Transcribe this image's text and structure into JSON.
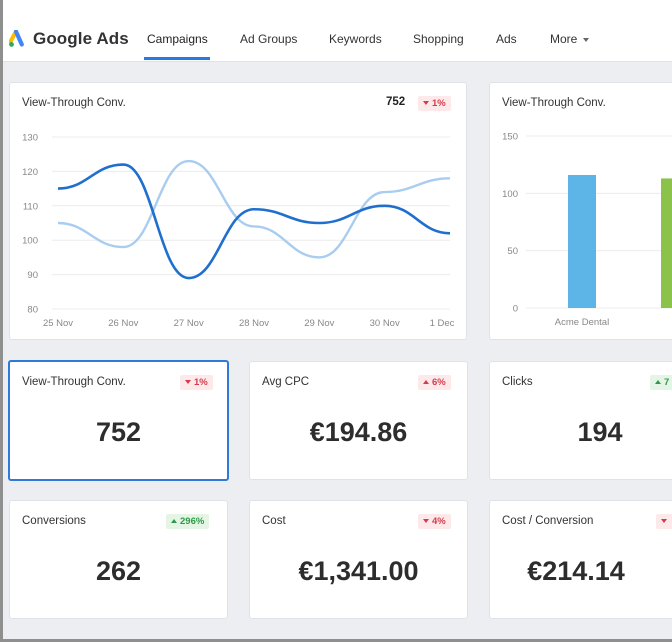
{
  "app": {
    "brand_name": "Google Ads",
    "nav": [
      {
        "label": "Campaigns",
        "active": true
      },
      {
        "label": "Ad Groups",
        "active": false
      },
      {
        "label": "Keywords",
        "active": false
      },
      {
        "label": "Shopping",
        "active": false
      },
      {
        "label": "Ads",
        "active": false
      },
      {
        "label": "More",
        "active": false
      }
    ],
    "accent_color": "#2b78e4"
  },
  "line_card": {
    "title": "View-Through Conv.",
    "total": "752",
    "badge": "1%"
  },
  "bar_card": {
    "title": "View-Through Conv."
  },
  "metrics": [
    {
      "title": "View-Through Conv.",
      "value": "752",
      "badge": "1%",
      "direction": "down",
      "badge_color": "#d23c4c"
    },
    {
      "title": "Avg CPC",
      "value": "€194.86",
      "badge": "6%",
      "direction": "up",
      "badge_color": "#d23c4c"
    },
    {
      "title": "Clicks",
      "value": "194",
      "badge": "7",
      "direction": "up",
      "badge_color": "#2f9a46"
    },
    {
      "title": "Conversions",
      "value": "262",
      "badge": "296%",
      "direction": "up",
      "badge_color": "#2f9a46"
    },
    {
      "title": "Cost",
      "value": "€1,341.00",
      "badge": "4%",
      "direction": "down",
      "badge_color": "#d23c4c"
    },
    {
      "title": "Cost / Conversion",
      "value": "€214.14",
      "badge": "",
      "direction": "down",
      "badge_color": "#d23c4c"
    }
  ],
  "chart_data": [
    {
      "type": "line",
      "title": "View-Through Conv.",
      "x": [
        "25 Nov",
        "26 Nov",
        "27 Nov",
        "28 Nov",
        "29 Nov",
        "30 Nov",
        "1 Dec"
      ],
      "ylim": [
        80,
        130
      ],
      "yticks": [
        80,
        90,
        100,
        110,
        120,
        130
      ],
      "grid": true,
      "series": [
        {
          "values": [
            115,
            122,
            89,
            109,
            105,
            110,
            102
          ],
          "color": "#1f6fcf"
        },
        {
          "values": [
            105,
            98,
            123,
            104,
            95,
            114,
            118
          ],
          "color": "#a9cdf0"
        }
      ]
    },
    {
      "type": "bar",
      "title": "View-Through Conv.",
      "categories": [
        "Acme Dental",
        "Ac"
      ],
      "values": [
        116,
        113
      ],
      "colors": [
        "#5db4e6",
        "#8bc34a"
      ],
      "ylim": [
        0,
        150
      ],
      "yticks": [
        0,
        50,
        100,
        150
      ],
      "grid": true
    }
  ]
}
